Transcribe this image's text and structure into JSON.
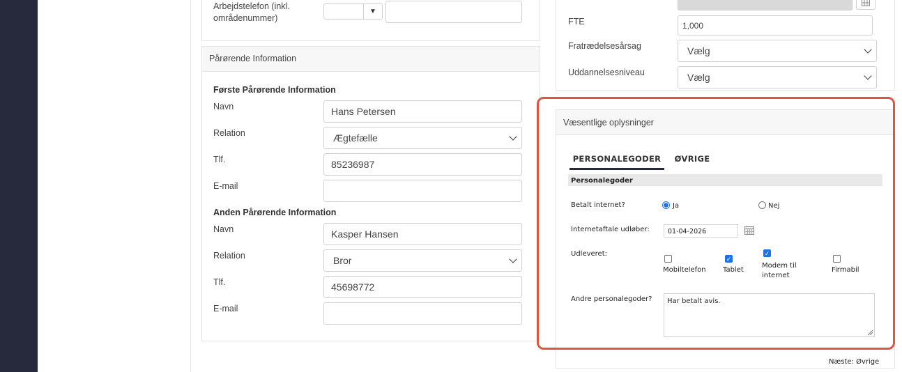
{
  "left_form": {
    "work_phone_label": "Arbejdstelefon (inkl. områdenummer)",
    "work_phone_code": "",
    "work_phone_number": ""
  },
  "relatives": {
    "header": "Pårørende Information",
    "first_title": "Første Pårørende Information",
    "second_title": "Anden Pårørende Information",
    "labels": {
      "name": "Navn",
      "relation": "Relation",
      "phone": "Tlf.",
      "email": "E-mail"
    },
    "first": {
      "name": "Hans Petersen",
      "relation": "Ægtefælle",
      "phone": "85236987",
      "email": ""
    },
    "second": {
      "name": "Kasper Hansen",
      "relation": "Bror",
      "phone": "45698772",
      "email": ""
    }
  },
  "right_form": {
    "fte_label": "FTE",
    "fte_value": "1,000",
    "resign_label": "Fratrædelsesårsag",
    "resign_value": "Vælg",
    "education_label": "Uddannelsesniveau",
    "education_value": "Vælg"
  },
  "benefits": {
    "header": "Væsentlige oplysninger",
    "tabs": [
      "PERSONALEGODER",
      "ØVRIGE"
    ],
    "section_title": "Personalegoder",
    "internet_label": "Betalt internet?",
    "yes_label": "Ja",
    "no_label": "Nej",
    "internet_paid": "Ja",
    "agreement_label": "Internetaftale udløber:",
    "agreement_date": "01-04-2026",
    "handed_label": "Udleveret:",
    "items": [
      {
        "label": "Mobiltelefon",
        "checked": false
      },
      {
        "label": "Tablet",
        "checked": true
      },
      {
        "label": "Modem til internet",
        "checked": true
      },
      {
        "label": "Firmabil",
        "checked": false
      }
    ],
    "other_label": "Andre personalegoder?",
    "other_value": "Har betalt avis.",
    "next_link": "Næste: Øvrige"
  },
  "colors": {
    "sidebar": "#262a3c",
    "highlight": "#dc5646",
    "accent": "#1a73e8"
  }
}
